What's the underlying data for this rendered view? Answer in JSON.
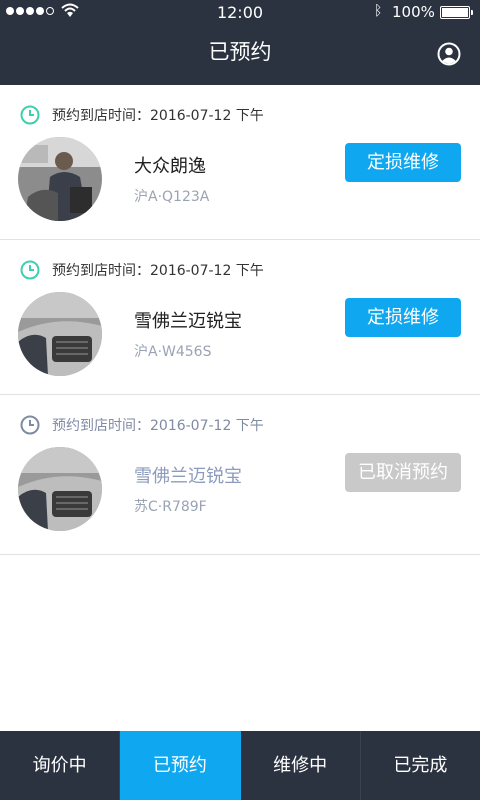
{
  "status_bar": {
    "time": "12:00",
    "battery": "100%"
  },
  "header": {
    "title": "已预约",
    "profile_icon": "user-circle-icon"
  },
  "appointments": [
    {
      "time_label": "预约到店时间：2016-07-12 下午",
      "car_name": "大众朗逸",
      "plate": "沪A·Q123A",
      "action": "定损维修",
      "status": "active"
    },
    {
      "time_label": "预约到店时间：2016-07-12 下午",
      "car_name": "雪佛兰迈锐宝",
      "plate": "沪A·W456S",
      "action": "定损维修",
      "status": "active"
    },
    {
      "time_label": "预约到店时间：2016-07-12 下午",
      "car_name": "雪佛兰迈锐宝",
      "plate": "苏C·R789F",
      "action": "已取消预约",
      "status": "cancelled"
    }
  ],
  "tabs": [
    {
      "label": "询价中"
    },
    {
      "label": "已预约"
    },
    {
      "label": "维修中"
    },
    {
      "label": "已完成"
    }
  ],
  "active_tab": "已预约",
  "colors": {
    "header_bg": "#2b3240",
    "accent": "#0fa8f0",
    "clock_icon": "#3ccfb0",
    "disabled": "#c9c9c9"
  }
}
